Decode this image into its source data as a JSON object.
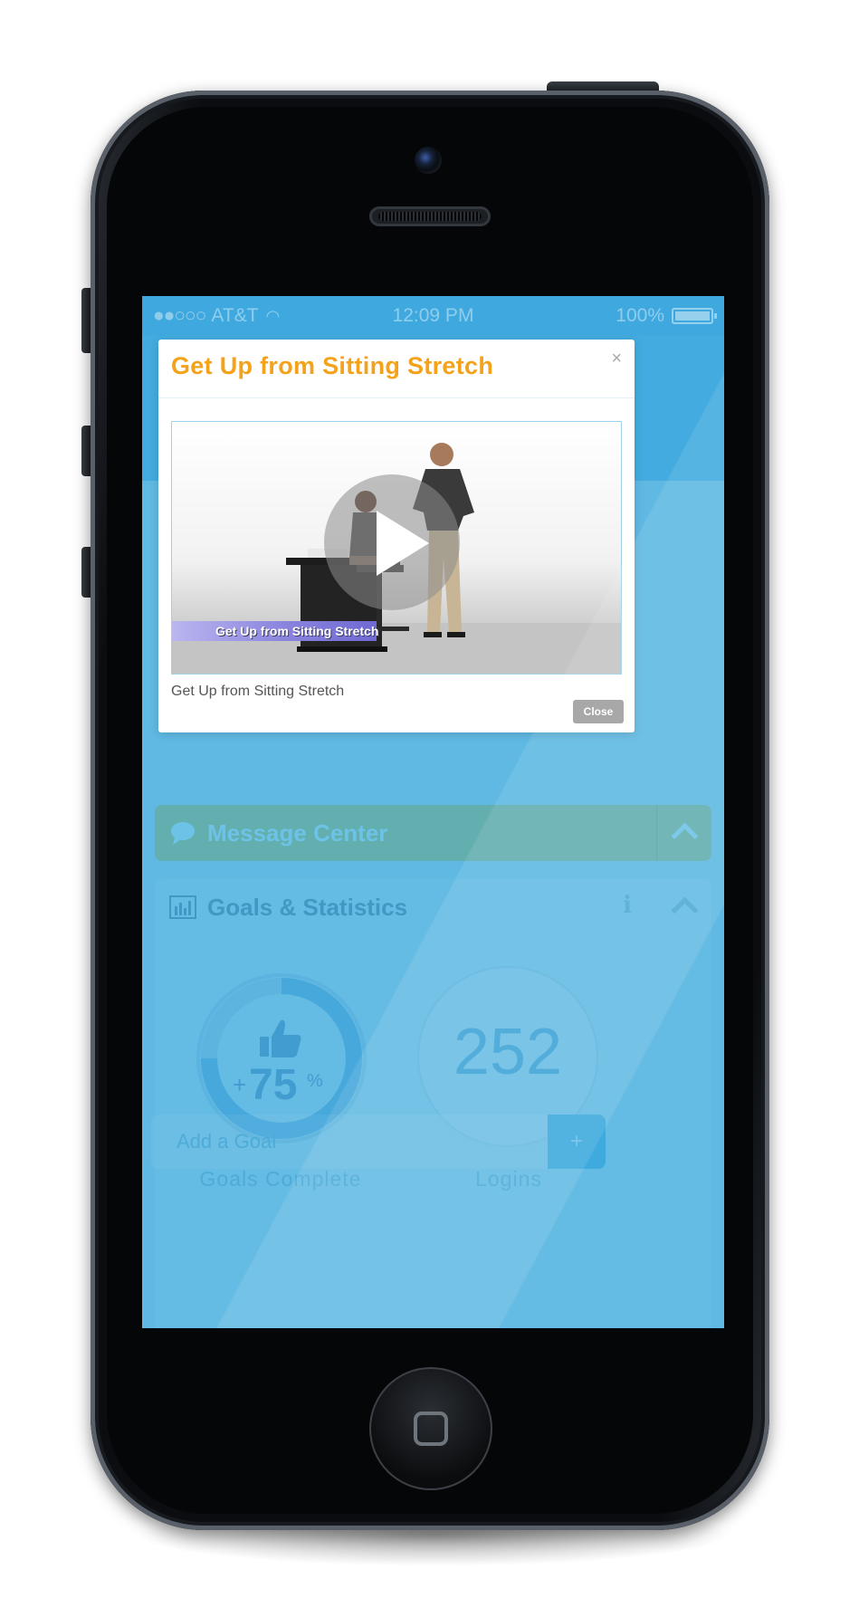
{
  "status_bar": {
    "signal": "●●○○○",
    "carrier": "AT&T",
    "time": "12:09 PM",
    "battery": "100%"
  },
  "message_center": {
    "title": "Message Center",
    "icon": "chat-bubble-icon"
  },
  "goals_statistics": {
    "title": "Goals & Statistics",
    "icon": "bar-chart-icon",
    "info": "i",
    "goals_complete": {
      "prefix": "+",
      "value": "75",
      "unit": "%",
      "label": "Goals Complete",
      "progress_fraction": 0.75
    },
    "logins": {
      "value": "252",
      "label": "Logins"
    },
    "add_goal": {
      "placeholder": "Add a Goal",
      "button": "+"
    }
  },
  "modal": {
    "title": "Get Up from Sitting Stretch",
    "close_x": "×",
    "video_caption": "Get Up from Sitting Stretch",
    "description": "Get Up from Sitting Stretch",
    "close_label": "Close"
  },
  "colors": {
    "accent_orange": "#f4a21a",
    "screen_blue": "#5fb9e2",
    "status_blue": "#3fa9df",
    "message_green": "#64aca8"
  }
}
